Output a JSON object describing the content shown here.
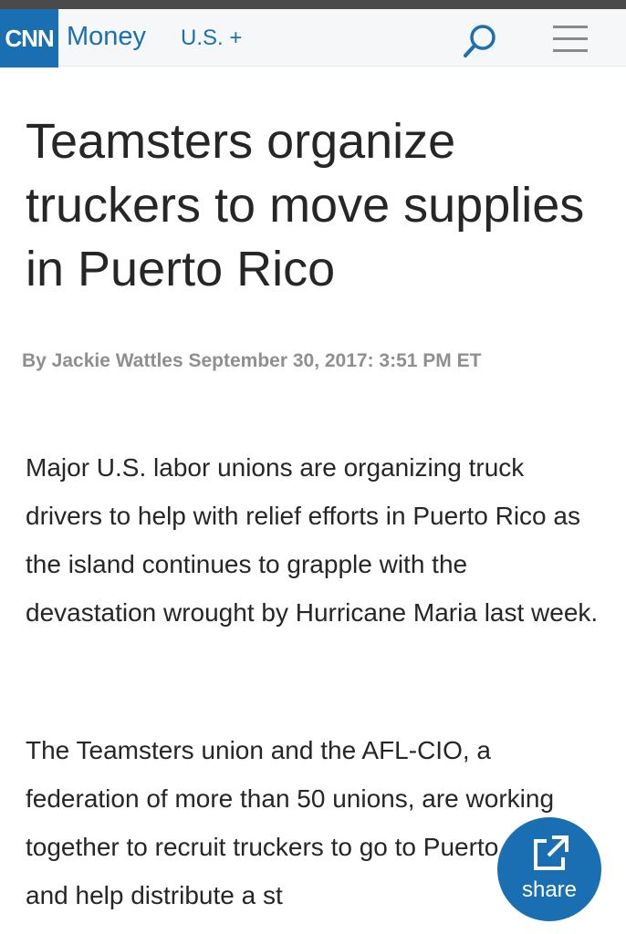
{
  "header": {
    "logo_text": "CNN",
    "brand": "Money",
    "section_menu": "U.S. +",
    "search_icon": "search-icon",
    "menu_icon": "hamburger-menu-icon",
    "brand_color": "#1a6fb3"
  },
  "article": {
    "headline": "Teamsters organize truckers to move supplies in Puerto Rico",
    "byline": "By Jackie Wattles September 30, 2017: 3:51 PM ET",
    "paragraphs": [
      "Major U.S. labor unions are organizing truck drivers to help with relief efforts in Puerto Rico as the island continues to grapple with the devastation wrought by Hurricane Maria last week.",
      "The Teamsters union and the AFL-CIO, a federation of more than 50 unions, are working together to recruit truckers to go to Puerto Rico and help distribute a st"
    ]
  },
  "share": {
    "label": "share",
    "icon": "share-external-icon"
  }
}
